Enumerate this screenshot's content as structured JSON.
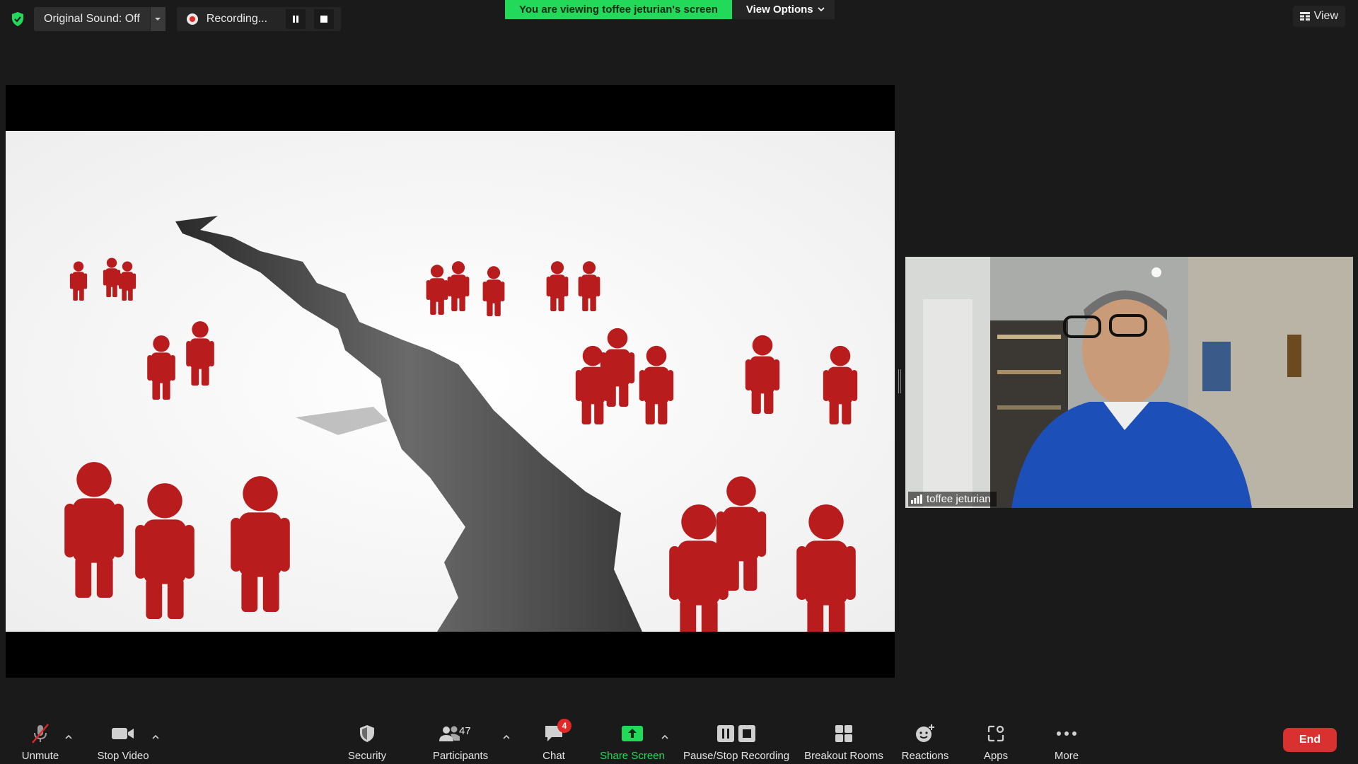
{
  "top_bar": {
    "original_sound_label": "Original Sound: Off",
    "recording_label": "Recording...",
    "viewing_banner": "You are viewing toffee jeturian's screen",
    "view_options_label": "View Options",
    "view_label": "View"
  },
  "speaker": {
    "name": "toffee jeturian"
  },
  "toolbar": {
    "unmute": "Unmute",
    "stop_video": "Stop Video",
    "security": "Security",
    "participants": "Participants",
    "participants_count": "47",
    "chat": "Chat",
    "chat_badge": "4",
    "share_screen": "Share Screen",
    "pause_stop_recording": "Pause/Stop Recording",
    "breakout_rooms": "Breakout Rooms",
    "reactions": "Reactions",
    "apps": "Apps",
    "more": "More",
    "end": "End"
  },
  "colors": {
    "accent_green": "#23d959",
    "end_red": "#d93030",
    "figure_red": "#b81c1c",
    "background": "#1a1a1a"
  }
}
